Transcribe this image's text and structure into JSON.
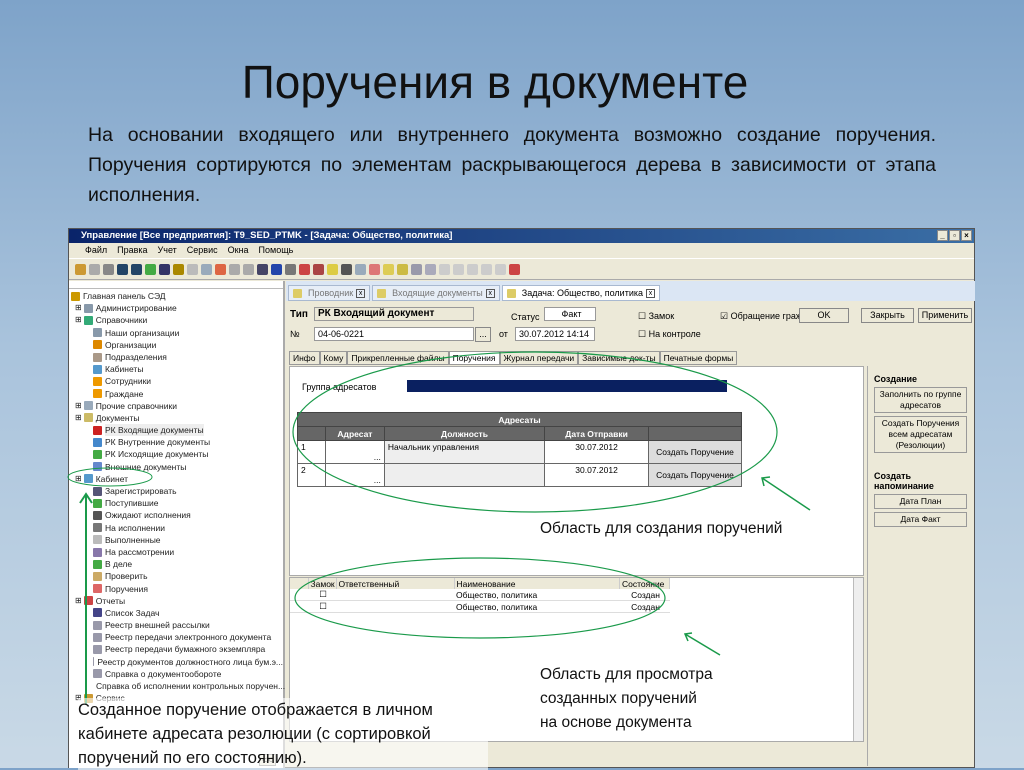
{
  "slide": {
    "title": "Поручения в документе",
    "paragraph": "На основании входящего или внутреннего документа возможно создание поручения. Поручения сортируются по элементам раскрывающегося дерева в зависимости от этапа исполнения.",
    "annotation_create": "Область для создания поручений",
    "annotation_view": [
      "Область для просмотра",
      "созданных поручений",
      "на основе документа"
    ],
    "annotation_cabinet": "Созданное поручение отображается в личном кабинете адресата резолюции (с сортировкой поручений по его состоянию).",
    "accent": "#1a9a4a"
  },
  "window": {
    "title": "Управление [Все предприятия]: T9_SED_PTMK - [Задача: Общество, политика]",
    "menu": [
      "Файл",
      "Правка",
      "Учет",
      "Сервис",
      "Окна",
      "Помощь"
    ]
  },
  "tree": [
    {
      "label": "Главная панель СЭД",
      "lvl": 0,
      "c": "#c90"
    },
    {
      "label": "Администрирование",
      "lvl": 1,
      "c": "#89a"
    },
    {
      "label": "Справочники",
      "lvl": 1,
      "c": "#3a7"
    },
    {
      "label": "Наши организации",
      "lvl": 2,
      "c": "#89a"
    },
    {
      "label": "Организации",
      "lvl": 2,
      "c": "#d80"
    },
    {
      "label": "Подразделения",
      "lvl": 2,
      "c": "#a98"
    },
    {
      "label": "Кабинеты",
      "lvl": 2,
      "c": "#59c"
    },
    {
      "label": "Сотрудники",
      "lvl": 2,
      "c": "#e90"
    },
    {
      "label": "Граждане",
      "lvl": 2,
      "c": "#e90"
    },
    {
      "label": "Прочие справочники",
      "lvl": 1,
      "c": "#9ab"
    },
    {
      "label": "Документы",
      "lvl": 1,
      "c": "#cb6"
    },
    {
      "label": "РК Входящие документы",
      "lvl": 2,
      "c": "#c22"
    },
    {
      "label": "РК Внутренние документы",
      "lvl": 2,
      "c": "#48c"
    },
    {
      "label": "РК Исходящие документы",
      "lvl": 2,
      "c": "#4a4"
    },
    {
      "label": "Внешние документы",
      "lvl": 2,
      "c": "#68c"
    },
    {
      "label": "Кабинет",
      "lvl": 1,
      "c": "#59c"
    },
    {
      "label": "Зарегистрировать",
      "lvl": 2,
      "c": "#557"
    },
    {
      "label": "Поступившие",
      "lvl": 2,
      "c": "#4a4"
    },
    {
      "label": "Ожидают исполнения",
      "lvl": 2,
      "c": "#555"
    },
    {
      "label": "На исполнении",
      "lvl": 2,
      "c": "#777"
    },
    {
      "label": "Выполненные",
      "lvl": 2,
      "c": "#bbb"
    },
    {
      "label": "На рассмотрении",
      "lvl": 2,
      "c": "#87a"
    },
    {
      "label": "В деле",
      "lvl": 2,
      "c": "#4a4"
    },
    {
      "label": "Проверить",
      "lvl": 2,
      "c": "#ca6"
    },
    {
      "label": "Поручения",
      "lvl": 2,
      "c": "#d66"
    },
    {
      "label": "Отчеты",
      "lvl": 1,
      "c": "#c44"
    },
    {
      "label": "Список Задач",
      "lvl": 2,
      "c": "#448"
    },
    {
      "label": "Реестр внешней рассылки",
      "lvl": 2,
      "c": "#99a"
    },
    {
      "label": "Реестр передачи электронного документа",
      "lvl": 2,
      "c": "#99a"
    },
    {
      "label": "Реестр передачи бумажного экземпляра",
      "lvl": 2,
      "c": "#99a"
    },
    {
      "label": "Реестр документов должностного лица бум.э...",
      "lvl": 2,
      "c": "#99a"
    },
    {
      "label": "Справка о документообороте",
      "lvl": 2,
      "c": "#99a"
    },
    {
      "label": "Справка об исполнении контрольных поручен...",
      "lvl": 2,
      "c": "#99a"
    },
    {
      "label": "Сервис",
      "lvl": 1,
      "c": "#c93"
    }
  ],
  "tabs": [
    {
      "label": "Проводник"
    },
    {
      "label": "Входящие документы"
    },
    {
      "label": "Задача: Общество, политика"
    }
  ],
  "form": {
    "type_label": "Тип",
    "type_value": "РК Входящий документ",
    "num_label": "№",
    "num_value": "04-06-0221",
    "from_label": "от",
    "date_value": "30.07.2012 14:14",
    "status_label": "Статус",
    "status_value": "Факт",
    "lock_label": "Замок",
    "control_label": "На контроле",
    "appeal_label": "Обращение гражд",
    "appeal_checked": true,
    "ok": "OK",
    "close": "Закрыть",
    "apply": "Применить",
    "dots": "..."
  },
  "inner_tabs": [
    "Инфо",
    "Кому",
    "Прикрепленные файлы",
    "Поручения",
    "Журнал передачи",
    "Зависимые док-ты",
    "Печатные формы"
  ],
  "group_label": "Группа адресатов",
  "addressees": {
    "caption": "Адресаты",
    "columns": [
      "Адресат",
      "Должность",
      "Дата Отправки"
    ],
    "rows": [
      {
        "n": "1",
        "position": "Начальник управления",
        "date": "30.07.2012",
        "button": "Создать Поручение"
      },
      {
        "n": "2",
        "position": "",
        "date": "30.07.2012",
        "button": "Создать Поручение"
      }
    ]
  },
  "side": {
    "create_header": "Создание",
    "fill_btn": "Заполнить по группе адресатов",
    "create_all_btn": "Создать Поручения всем адресатам (Резолюции)",
    "remind_header": "Создать напоминание",
    "plan_btn": "Дата План",
    "fact_btn": "Дата Факт"
  },
  "tasks": {
    "columns": [
      "Замок",
      "Ответственный",
      "Наименование",
      "Состояние"
    ],
    "rows": [
      {
        "name": "Общество, политика",
        "state": "Создан"
      },
      {
        "name": "Общество, политика",
        "state": "Создан"
      }
    ]
  },
  "collapse_btn": "<<"
}
